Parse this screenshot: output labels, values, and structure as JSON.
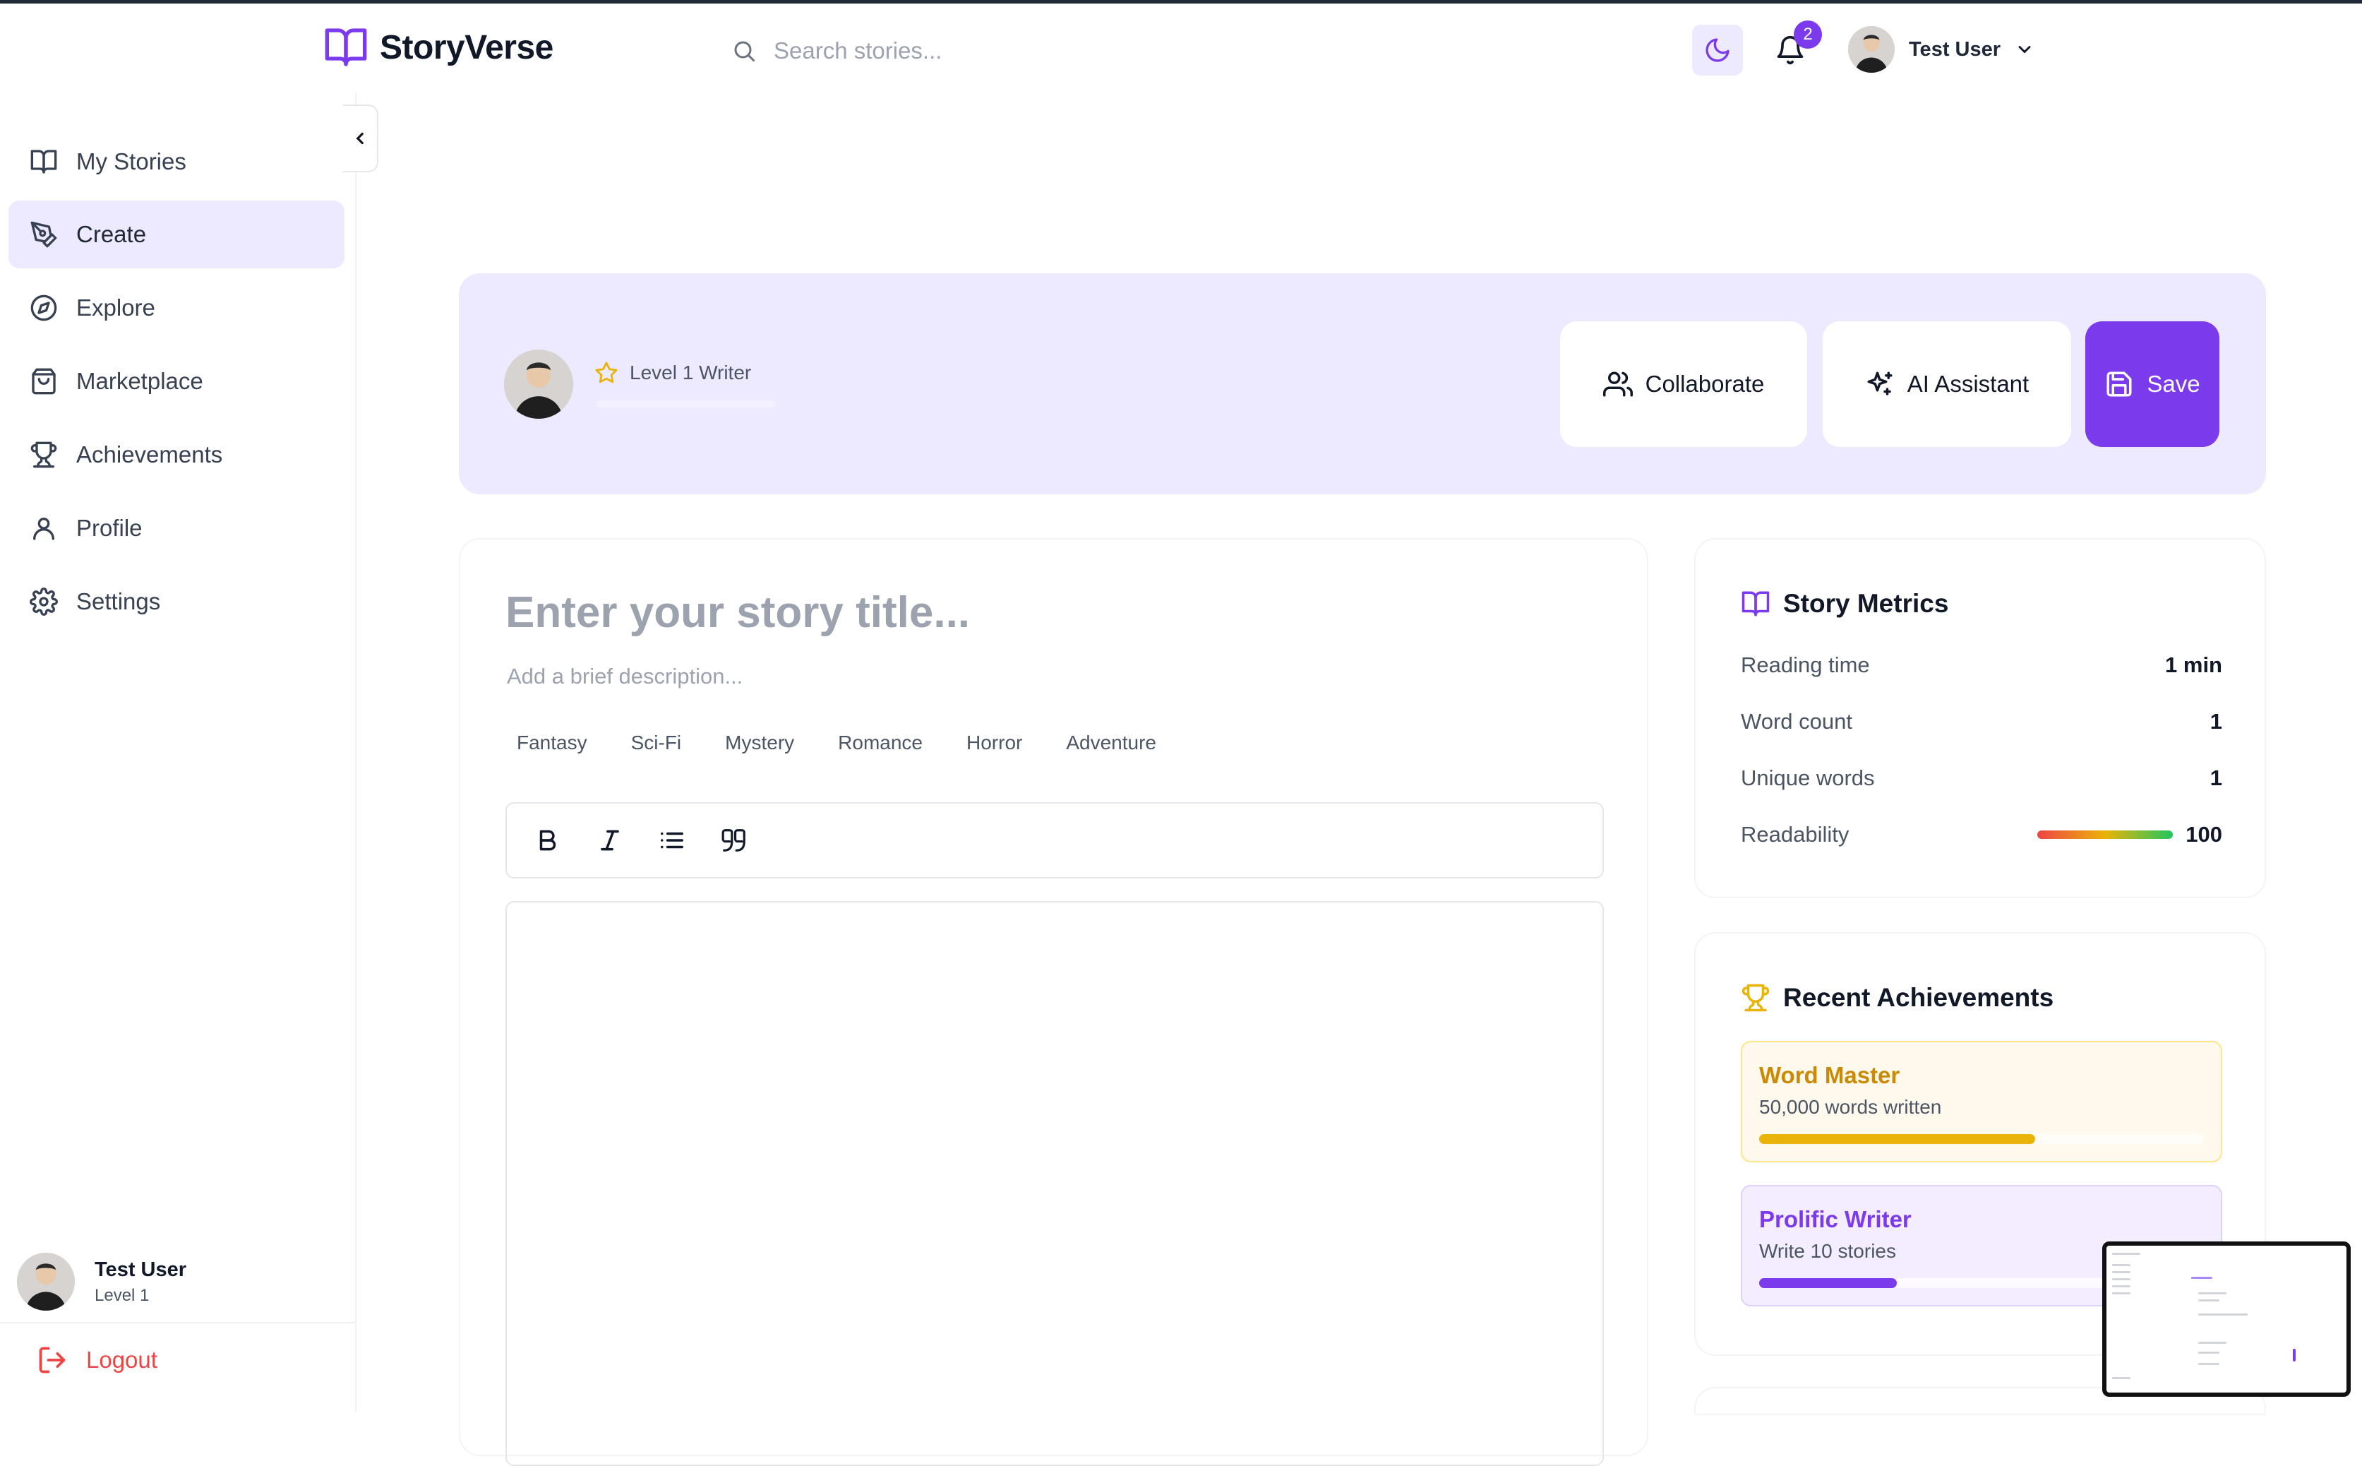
{
  "app": {
    "name": "StoryVerse",
    "brand_color": "#7c3aed"
  },
  "header": {
    "search_placeholder": "Search stories...",
    "notification_count": "2",
    "user_name": "Test User"
  },
  "sidebar": {
    "items": [
      {
        "label": "My Stories",
        "icon": "book-open-icon"
      },
      {
        "label": "Create",
        "icon": "pen-tool-icon",
        "active": true
      },
      {
        "label": "Explore",
        "icon": "compass-icon"
      },
      {
        "label": "Marketplace",
        "icon": "shopping-bag-icon"
      },
      {
        "label": "Achievements",
        "icon": "trophy-icon"
      },
      {
        "label": "Profile",
        "icon": "user-icon"
      },
      {
        "label": "Settings",
        "icon": "gear-icon"
      }
    ],
    "user": {
      "name": "Test User",
      "level": "Level 1"
    },
    "logout_label": "Logout"
  },
  "banner": {
    "level_label": "Level 1 Writer",
    "collaborate_label": "Collaborate",
    "ai_label": "AI Assistant",
    "save_label": "Save"
  },
  "editor": {
    "title_placeholder": "Enter your story title...",
    "description_placeholder": "Add a brief description...",
    "genres": [
      "Fantasy",
      "Sci-Fi",
      "Mystery",
      "Romance",
      "Horror",
      "Adventure"
    ],
    "toolbar": [
      "bold-icon",
      "italic-icon",
      "list-icon",
      "quote-icon"
    ]
  },
  "metrics": {
    "title": "Story Metrics",
    "rows": [
      {
        "label": "Reading time",
        "value": "1 min"
      },
      {
        "label": "Word count",
        "value": "1"
      },
      {
        "label": "Unique words",
        "value": "1"
      },
      {
        "label": "Readability",
        "value": "100"
      }
    ]
  },
  "achievements": {
    "title": "Recent Achievements",
    "items": [
      {
        "title": "Word Master",
        "description": "50,000 words written",
        "progress": 0.62,
        "color": "#eab308"
      },
      {
        "title": "Prolific Writer",
        "description": "Write 10 stories",
        "progress": 0.31,
        "color": "#7c3aed"
      }
    ]
  }
}
